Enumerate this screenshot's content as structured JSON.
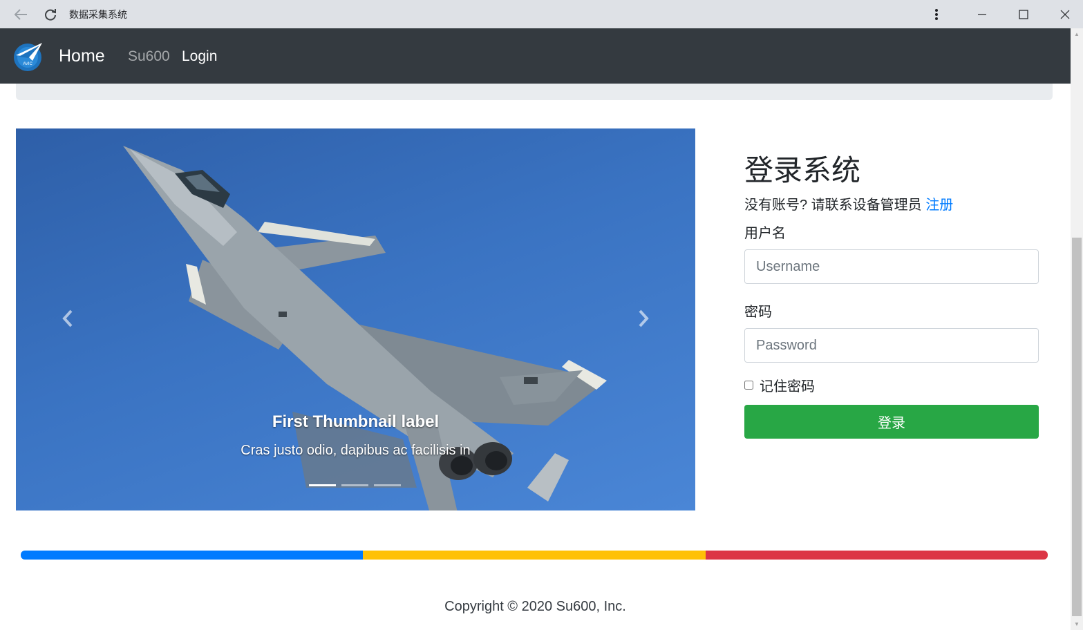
{
  "window": {
    "title": "数据采集系统",
    "icons": {
      "back": "back-arrow-icon",
      "reload": "reload-icon",
      "menu": "more-vert-icon",
      "minimize": "minimize-icon",
      "maximize": "maximize-icon",
      "close": "close-icon"
    }
  },
  "navbar": {
    "brand": "Home",
    "links": [
      "Su600",
      "Login"
    ],
    "logo_text": "AVIC",
    "background": "#343a40"
  },
  "carousel": {
    "caption_title": "First Thumbnail label",
    "caption_text": "Cras justo odio, dapibus ac facilisis in",
    "active_slide": 1,
    "slide_count": 3,
    "prev_icon": "chevron-left-icon",
    "next_icon": "chevron-right-icon"
  },
  "login": {
    "heading": "登录系统",
    "hint": "没有账号? 请联系设备管理员",
    "register_link": "注册",
    "username_label": "用户名",
    "username_placeholder": "Username",
    "username_value": "",
    "password_label": "密码",
    "password_placeholder": "Password",
    "password_value": "",
    "remember_label": "记住密码",
    "remember_checked": false,
    "submit_label": "登录",
    "submit_color": "#28a745",
    "link_color": "#007bff"
  },
  "colorbar": [
    "#007bff",
    "#ffc107",
    "#dc3545"
  ],
  "footer": {
    "copyright": "Copyright © 2020 Su600, Inc."
  }
}
